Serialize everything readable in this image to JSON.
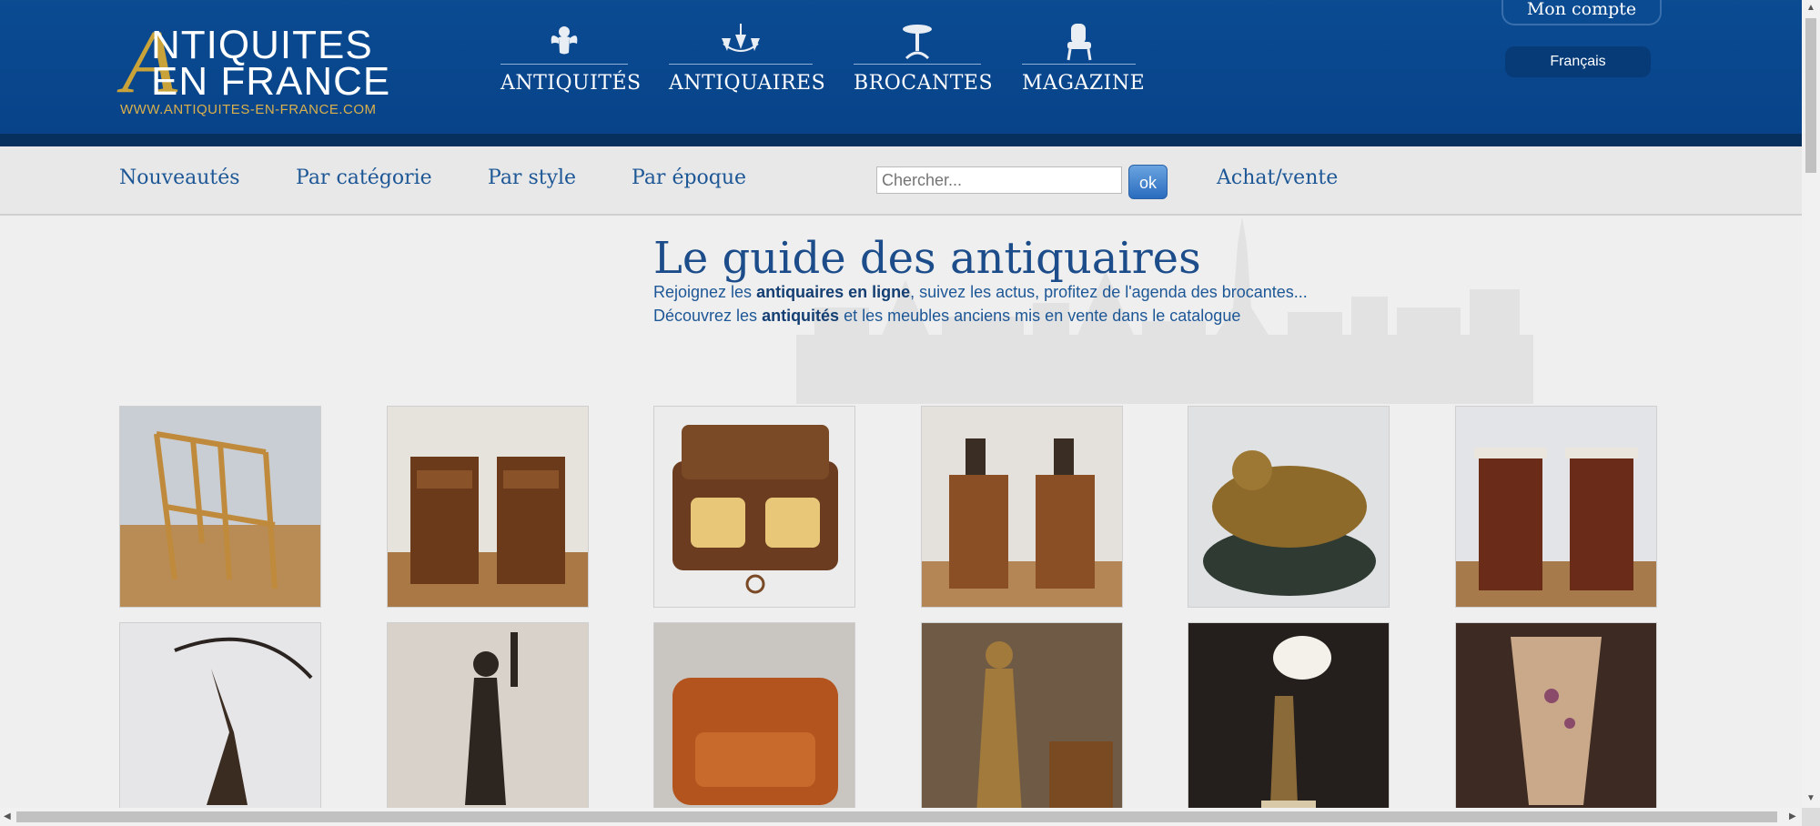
{
  "header": {
    "logo": {
      "big_letter": "A",
      "line1": "NTIQUITES",
      "line2": "EN FRANCE",
      "url": "WWW.ANTIQUITES-EN-FRANCE.COM"
    },
    "main_nav": [
      {
        "label": "ANTIQUITÉS",
        "icon": "cherub-icon"
      },
      {
        "label": "ANTIQUAIRES",
        "icon": "chandelier-icon"
      },
      {
        "label": "BROCANTES",
        "icon": "pedestal-table-icon"
      },
      {
        "label": "MAGAZINE",
        "icon": "armchair-icon"
      }
    ],
    "account_label": "Mon compte",
    "language_label": "Français"
  },
  "subnav": {
    "links": [
      "Nouveautés",
      "Par catégorie",
      "Par style",
      "Par époque"
    ],
    "search": {
      "placeholder": "Chercher...",
      "button": "ok"
    },
    "buy_sell": "Achat/vente"
  },
  "hero": {
    "title": "Le guide des antiquaires",
    "line1": {
      "pre": "Rejoignez les ",
      "bold": "antiquaires en ligne",
      "post": ", suivez les actus, profitez de l'agenda des brocantes..."
    },
    "line2": {
      "pre": "Découvrez les ",
      "bold": "antiquités",
      "post": " et les meubles anciens mis en vente dans le catalogue"
    }
  },
  "products": [
    {
      "name": "bamboo-armchair-photo"
    },
    {
      "name": "pair-nightstands-photo"
    },
    {
      "name": "inkwell-box-photo"
    },
    {
      "name": "side-tables-bronzes-photo"
    },
    {
      "name": "bronze-cherub-sculpture-photo"
    },
    {
      "name": "marble-top-nightstands-photo"
    },
    {
      "name": "archer-bronze-photo"
    },
    {
      "name": "torch-bearer-bronze-photo"
    },
    {
      "name": "leather-sofa-photo"
    },
    {
      "name": "bronze-woman-statue-photo"
    },
    {
      "name": "art-deco-lamp-photo"
    },
    {
      "name": "glass-vase-photo"
    }
  ],
  "colors": {
    "header_blue": "#0a4b92",
    "header_dark": "#07305e",
    "gold": "#c9a33a",
    "link_blue": "#1d5796"
  }
}
